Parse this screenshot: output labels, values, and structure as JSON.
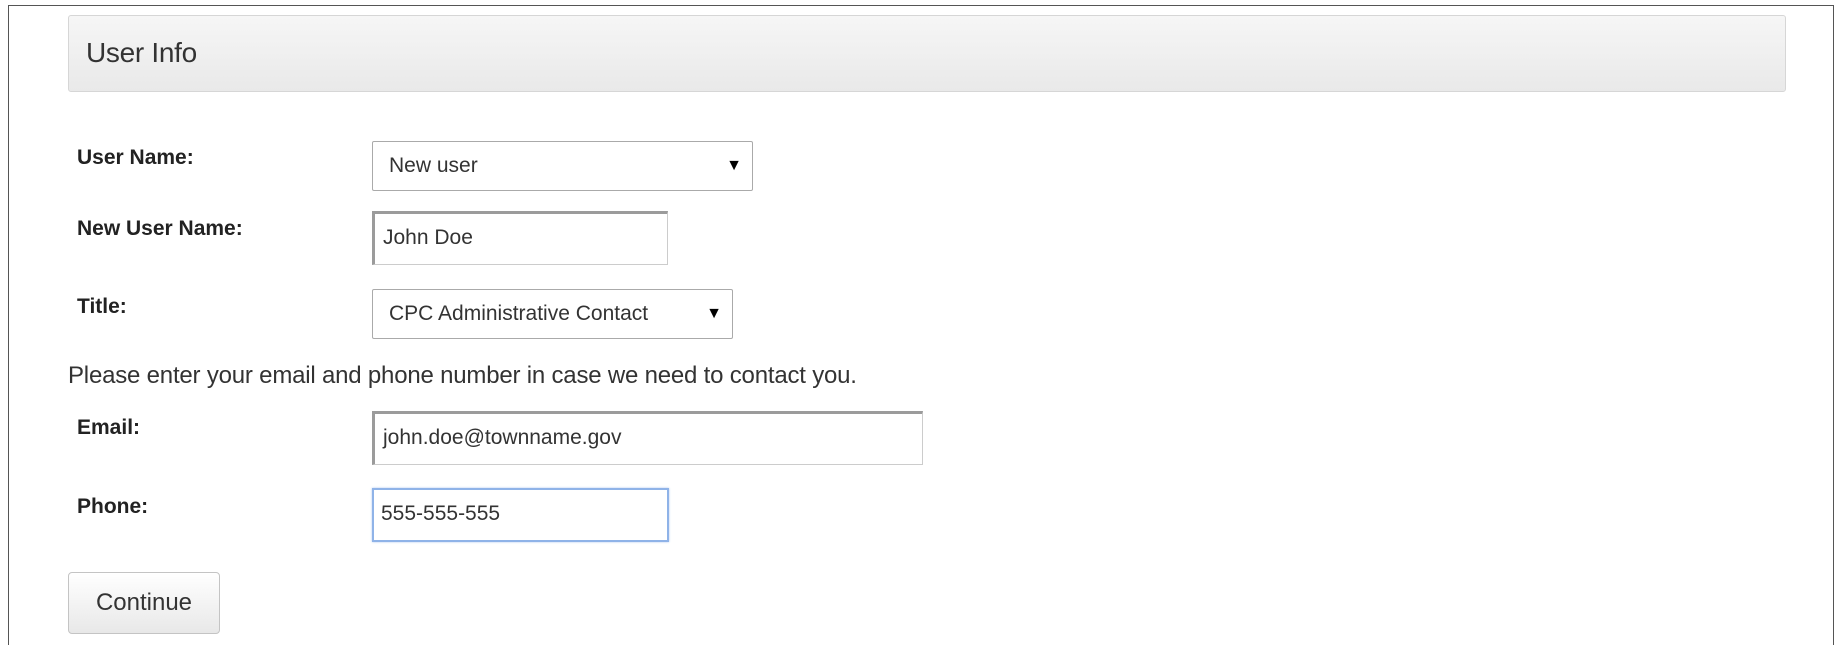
{
  "panel": {
    "title": "User Info"
  },
  "form": {
    "user_name": {
      "label": "User Name:",
      "selected": "New user"
    },
    "new_user_name": {
      "label": "New User Name:",
      "value": "John Doe"
    },
    "title": {
      "label": "Title:",
      "selected": "CPC Administrative Contact"
    },
    "help_text": "Please enter your email and phone number in case we need to contact you.",
    "email": {
      "label": "Email:",
      "value": "john.doe@townname.gov"
    },
    "phone": {
      "label": "Phone:",
      "value": "555-555-555"
    },
    "continue_label": "Continue"
  },
  "icons": {
    "dropdown_arrow": "▼"
  },
  "colors": {
    "focus_border": "#8fb3e8",
    "heading_bg": "#eeeeee"
  }
}
